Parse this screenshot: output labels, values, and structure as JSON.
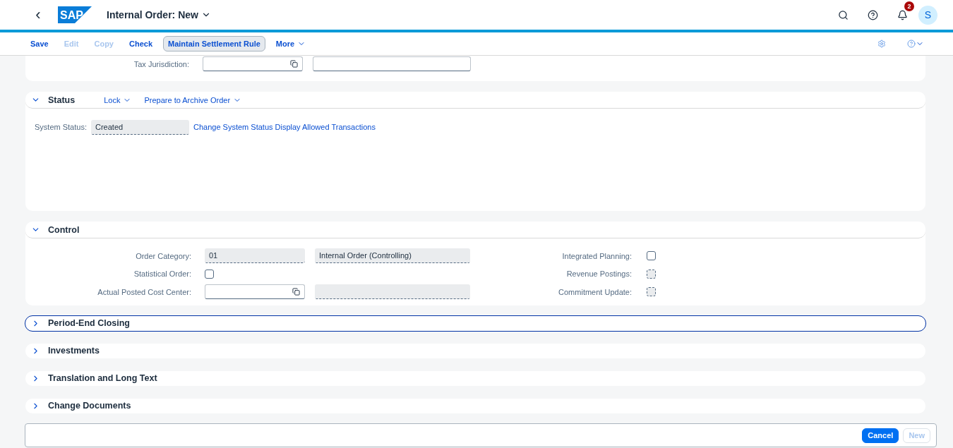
{
  "shell": {
    "back": "‹",
    "logo": "SAP",
    "title": "Internal Order: New",
    "notifications": "2",
    "avatar": "S"
  },
  "toolbar": [
    {
      "label": "Save",
      "kind": "button",
      "disabled": false,
      "pressed": false
    },
    {
      "label": "Edit",
      "kind": "button",
      "disabled": true,
      "pressed": false
    },
    {
      "label": "Copy",
      "kind": "button",
      "disabled": true,
      "pressed": false
    },
    {
      "label": "Check",
      "kind": "button",
      "disabled": false,
      "pressed": false
    },
    {
      "label": "Maintain Settlement Rule",
      "kind": "button",
      "disabled": false,
      "pressed": true
    },
    {
      "label": "More",
      "kind": "menu",
      "disabled": false,
      "pressed": false
    }
  ],
  "tax": {
    "label": "Tax Jurisdiction:"
  },
  "status": {
    "title": "Status",
    "expanded": true,
    "actions": [
      "Lock",
      "Prepare to Archive Order"
    ],
    "label": "System Status:",
    "value": "Created",
    "links": [
      "Change System Status",
      "Display Allowed Transactions"
    ]
  },
  "control": {
    "title": "Control",
    "expanded": true,
    "rows": [
      {
        "label": "Order Category:",
        "kind": "fields",
        "value": "01",
        "description": "Internal Order (Controlling)",
        "right_label": "Integrated Planning:",
        "right_checked": false,
        "right_disabled": false
      },
      {
        "label": "Statistical Order:",
        "kind": "checkbox",
        "checked": false,
        "right_label": "Revenue Postings:",
        "right_checked": false,
        "right_disabled": true
      },
      {
        "label": "Actual Posted Cost Center:",
        "kind": "valuehelp",
        "right_label": "Commitment Update:",
        "right_checked": false,
        "right_disabled": true
      }
    ]
  },
  "sections": [
    {
      "title": "Period-End Closing",
      "expanded": false,
      "focused": true
    },
    {
      "title": "Investments",
      "expanded": false,
      "focused": false
    },
    {
      "title": "Translation and Long Text",
      "expanded": false,
      "focused": false
    },
    {
      "title": "Change Documents",
      "expanded": false,
      "focused": false
    }
  ],
  "footer": [
    {
      "label": "Cancel",
      "emphasized": true,
      "disabled": false
    },
    {
      "label": "New",
      "emphasized": false,
      "disabled": true
    }
  ]
}
